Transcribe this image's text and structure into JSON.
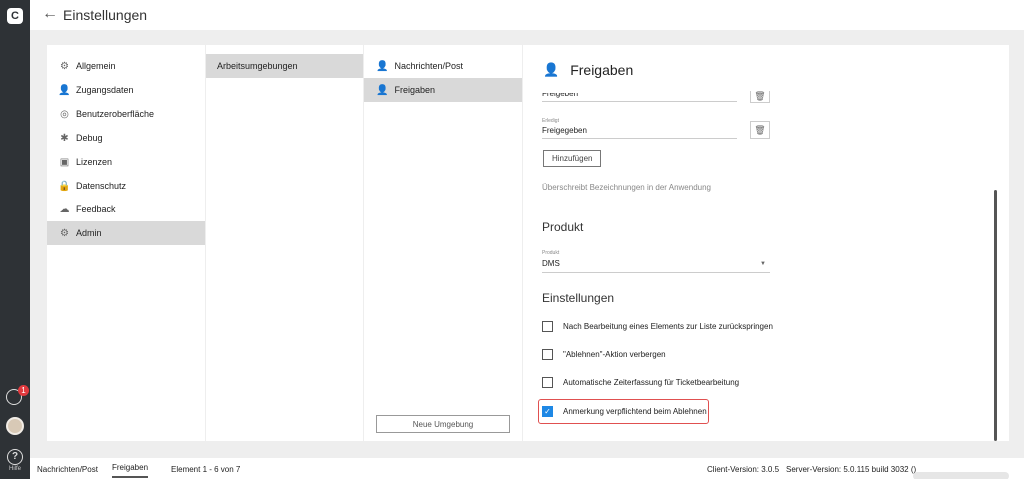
{
  "app": {
    "title": "Einstellungen",
    "logo": "C"
  },
  "rail": {
    "badge": "1",
    "help_label": "Hilfe"
  },
  "nav": [
    {
      "label": "Allgemein",
      "icon": "gear-icon"
    },
    {
      "label": "Zugangsdaten",
      "icon": "user-icon"
    },
    {
      "label": "Benutzeroberfläche",
      "icon": "palette-icon"
    },
    {
      "label": "Debug",
      "icon": "bug-icon"
    },
    {
      "label": "Lizenzen",
      "icon": "license-icon"
    },
    {
      "label": "Datenschutz",
      "icon": "lock-icon"
    },
    {
      "label": "Feedback",
      "icon": "feedback-icon"
    },
    {
      "label": "Admin",
      "icon": "admin-gear-icon"
    }
  ],
  "environments": {
    "item": "Arbeitsumgebungen"
  },
  "subnav": {
    "items": [
      {
        "label": "Nachrichten/Post"
      },
      {
        "label": "Freigaben"
      }
    ],
    "new_button": "Neue Umgebung"
  },
  "detail": {
    "title": "Freigaben",
    "partial_value": "Freigeben",
    "field_label": "Erledigt",
    "field_value": "Freigegeben",
    "add_button": "Hinzufügen",
    "hint": "Überschreibt Bezeichnungen in der Anwendung",
    "product_section": "Produkt",
    "product_label": "Produkt",
    "product_value": "DMS",
    "settings_section": "Einstellungen",
    "checkboxes": [
      {
        "label": "Nach Bearbeitung eines Elements zur Liste zurückspringen",
        "checked": false
      },
      {
        "label": "\"Ablehnen\"-Aktion verbergen",
        "checked": false
      },
      {
        "label": "Automatische Zeiterfassung für Ticketbearbeitung",
        "checked": false
      },
      {
        "label": "Anmerkung verpflichtend beim Ablehnen",
        "checked": true
      }
    ]
  },
  "status": {
    "tab1": "Nachrichten/Post",
    "tab2": "Freigaben",
    "count": "Element 1 - 6 von 7",
    "client": "Client-Version: 3.0.5",
    "server": "Server-Version: 5.0.115 build 3032 ("
  }
}
